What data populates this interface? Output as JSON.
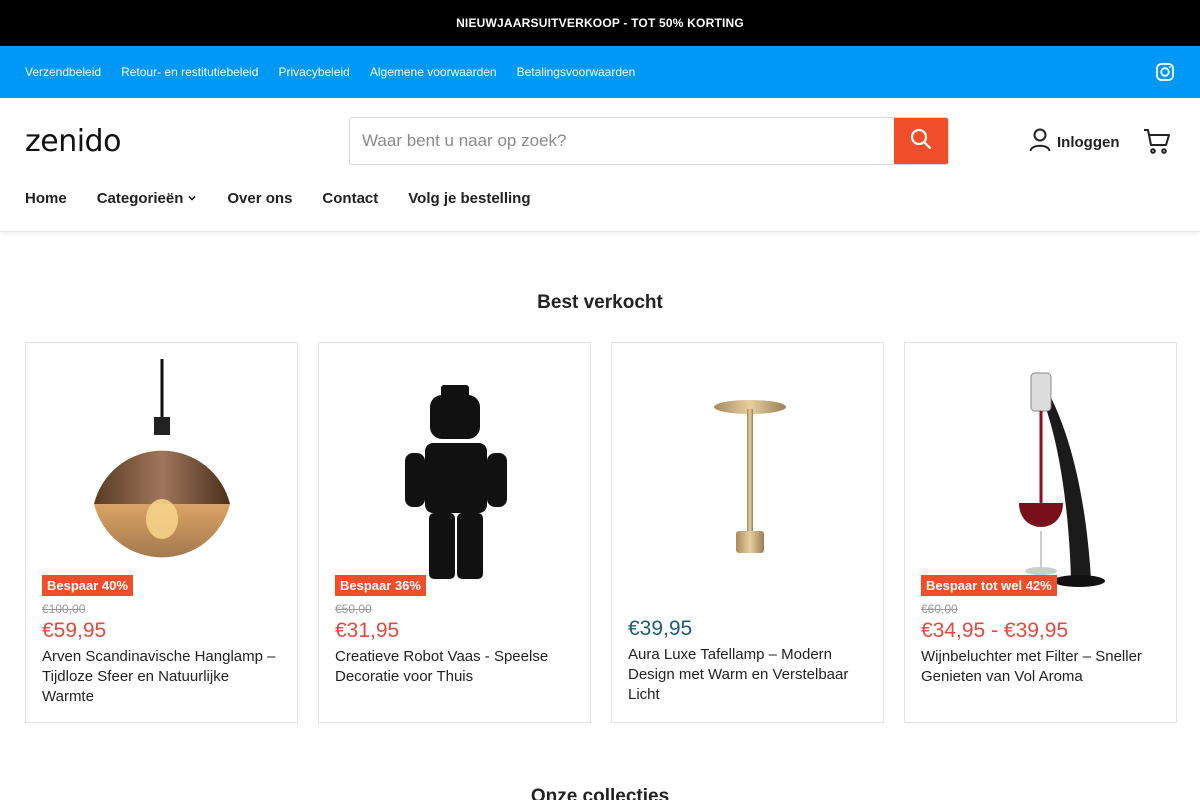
{
  "announcement": "NIEUWJAARSUITVERKOOP - TOT 50% KORTING",
  "utility_links": [
    "Verzendbeleid",
    "Retour- en restitutiebeleid",
    "Privacybeleid",
    "Algemene voorwaarden",
    "Betalingsvoorwaarden"
  ],
  "logo": "zenido",
  "search": {
    "placeholder": "Waar bent u naar op zoek?"
  },
  "account": {
    "login_label": "Inloggen"
  },
  "nav": [
    "Home",
    "Categorieën",
    "Over ons",
    "Contact",
    "Volg je bestelling"
  ],
  "bestsellers": {
    "title": "Best verkocht",
    "products": [
      {
        "badge": "Bespaar 40%",
        "old_price": "€100,00",
        "price": "€59,95",
        "title": "Arven Scandinavische Hanglamp – Tijdloze Sfeer en Natuurlijke Warmte"
      },
      {
        "badge": "Bespaar 36%",
        "old_price": "€50,00",
        "price": "€31,95",
        "title": "Creatieve Robot Vaas - Speelse Decoratie voor Thuis"
      },
      {
        "price": "€39,95",
        "title": "Aura Luxe Tafellamp – Modern Design met Warm en Verstelbaar Licht"
      },
      {
        "badge": "Bespaar tot wel 42%",
        "old_price": "€60,00",
        "price": "€34,95 - €39,95",
        "title": "Wijnbeluchter met Filter – Sneller Genieten van Vol Aroma"
      }
    ]
  },
  "collections": {
    "title": "Onze collecties"
  },
  "colors": {
    "announcement_bg": "#000000",
    "utility_bg": "#0098f7",
    "accent": "#f04e2b",
    "price_sale": "#e8483c",
    "price_regular": "#1b5e73"
  }
}
